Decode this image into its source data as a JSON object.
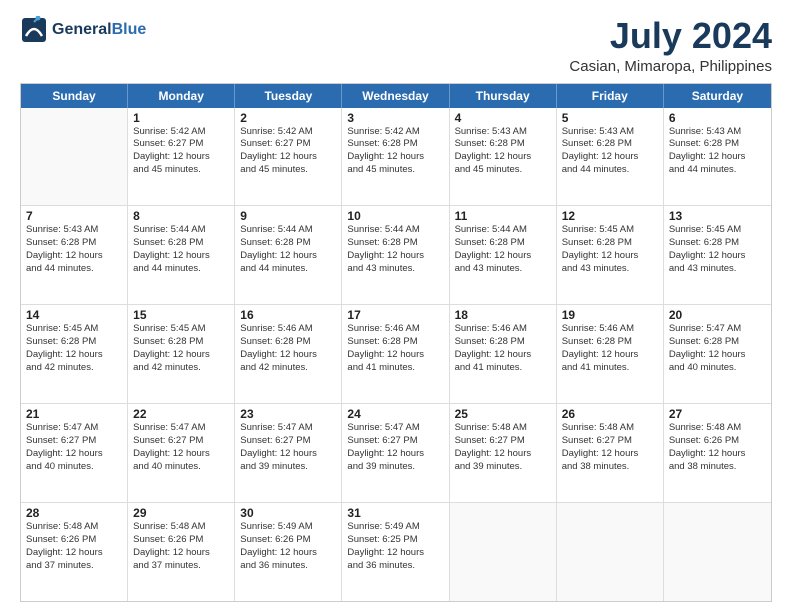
{
  "logo": {
    "line1": "General",
    "line2": "Blue"
  },
  "title": "July 2024",
  "subtitle": "Casian, Mimaropa, Philippines",
  "header_days": [
    "Sunday",
    "Monday",
    "Tuesday",
    "Wednesday",
    "Thursday",
    "Friday",
    "Saturday"
  ],
  "weeks": [
    [
      {
        "day": "",
        "info": ""
      },
      {
        "day": "1",
        "info": "Sunrise: 5:42 AM\nSunset: 6:27 PM\nDaylight: 12 hours\nand 45 minutes."
      },
      {
        "day": "2",
        "info": "Sunrise: 5:42 AM\nSunset: 6:27 PM\nDaylight: 12 hours\nand 45 minutes."
      },
      {
        "day": "3",
        "info": "Sunrise: 5:42 AM\nSunset: 6:28 PM\nDaylight: 12 hours\nand 45 minutes."
      },
      {
        "day": "4",
        "info": "Sunrise: 5:43 AM\nSunset: 6:28 PM\nDaylight: 12 hours\nand 45 minutes."
      },
      {
        "day": "5",
        "info": "Sunrise: 5:43 AM\nSunset: 6:28 PM\nDaylight: 12 hours\nand 44 minutes."
      },
      {
        "day": "6",
        "info": "Sunrise: 5:43 AM\nSunset: 6:28 PM\nDaylight: 12 hours\nand 44 minutes."
      }
    ],
    [
      {
        "day": "7",
        "info": "Sunrise: 5:43 AM\nSunset: 6:28 PM\nDaylight: 12 hours\nand 44 minutes."
      },
      {
        "day": "8",
        "info": "Sunrise: 5:44 AM\nSunset: 6:28 PM\nDaylight: 12 hours\nand 44 minutes."
      },
      {
        "day": "9",
        "info": "Sunrise: 5:44 AM\nSunset: 6:28 PM\nDaylight: 12 hours\nand 44 minutes."
      },
      {
        "day": "10",
        "info": "Sunrise: 5:44 AM\nSunset: 6:28 PM\nDaylight: 12 hours\nand 43 minutes."
      },
      {
        "day": "11",
        "info": "Sunrise: 5:44 AM\nSunset: 6:28 PM\nDaylight: 12 hours\nand 43 minutes."
      },
      {
        "day": "12",
        "info": "Sunrise: 5:45 AM\nSunset: 6:28 PM\nDaylight: 12 hours\nand 43 minutes."
      },
      {
        "day": "13",
        "info": "Sunrise: 5:45 AM\nSunset: 6:28 PM\nDaylight: 12 hours\nand 43 minutes."
      }
    ],
    [
      {
        "day": "14",
        "info": "Sunrise: 5:45 AM\nSunset: 6:28 PM\nDaylight: 12 hours\nand 42 minutes."
      },
      {
        "day": "15",
        "info": "Sunrise: 5:45 AM\nSunset: 6:28 PM\nDaylight: 12 hours\nand 42 minutes."
      },
      {
        "day": "16",
        "info": "Sunrise: 5:46 AM\nSunset: 6:28 PM\nDaylight: 12 hours\nand 42 minutes."
      },
      {
        "day": "17",
        "info": "Sunrise: 5:46 AM\nSunset: 6:28 PM\nDaylight: 12 hours\nand 41 minutes."
      },
      {
        "day": "18",
        "info": "Sunrise: 5:46 AM\nSunset: 6:28 PM\nDaylight: 12 hours\nand 41 minutes."
      },
      {
        "day": "19",
        "info": "Sunrise: 5:46 AM\nSunset: 6:28 PM\nDaylight: 12 hours\nand 41 minutes."
      },
      {
        "day": "20",
        "info": "Sunrise: 5:47 AM\nSunset: 6:28 PM\nDaylight: 12 hours\nand 40 minutes."
      }
    ],
    [
      {
        "day": "21",
        "info": "Sunrise: 5:47 AM\nSunset: 6:27 PM\nDaylight: 12 hours\nand 40 minutes."
      },
      {
        "day": "22",
        "info": "Sunrise: 5:47 AM\nSunset: 6:27 PM\nDaylight: 12 hours\nand 40 minutes."
      },
      {
        "day": "23",
        "info": "Sunrise: 5:47 AM\nSunset: 6:27 PM\nDaylight: 12 hours\nand 39 minutes."
      },
      {
        "day": "24",
        "info": "Sunrise: 5:47 AM\nSunset: 6:27 PM\nDaylight: 12 hours\nand 39 minutes."
      },
      {
        "day": "25",
        "info": "Sunrise: 5:48 AM\nSunset: 6:27 PM\nDaylight: 12 hours\nand 39 minutes."
      },
      {
        "day": "26",
        "info": "Sunrise: 5:48 AM\nSunset: 6:27 PM\nDaylight: 12 hours\nand 38 minutes."
      },
      {
        "day": "27",
        "info": "Sunrise: 5:48 AM\nSunset: 6:26 PM\nDaylight: 12 hours\nand 38 minutes."
      }
    ],
    [
      {
        "day": "28",
        "info": "Sunrise: 5:48 AM\nSunset: 6:26 PM\nDaylight: 12 hours\nand 37 minutes."
      },
      {
        "day": "29",
        "info": "Sunrise: 5:48 AM\nSunset: 6:26 PM\nDaylight: 12 hours\nand 37 minutes."
      },
      {
        "day": "30",
        "info": "Sunrise: 5:49 AM\nSunset: 6:26 PM\nDaylight: 12 hours\nand 36 minutes."
      },
      {
        "day": "31",
        "info": "Sunrise: 5:49 AM\nSunset: 6:25 PM\nDaylight: 12 hours\nand 36 minutes."
      },
      {
        "day": "",
        "info": ""
      },
      {
        "day": "",
        "info": ""
      },
      {
        "day": "",
        "info": ""
      }
    ]
  ]
}
